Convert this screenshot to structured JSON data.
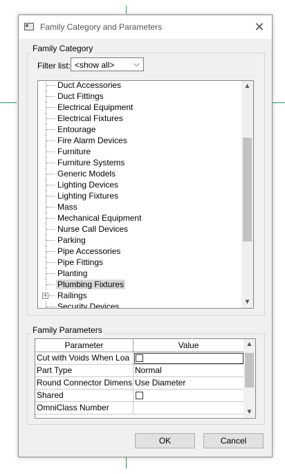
{
  "dialog": {
    "title": "Family Category and Parameters",
    "close_glyph": "✕"
  },
  "family_category": {
    "group_label": "Family Category",
    "filter_label": "Filter list:",
    "filter_value": "<show all>",
    "items": [
      {
        "label": "Duct Accessories"
      },
      {
        "label": "Duct Fittings"
      },
      {
        "label": "Electrical Equipment"
      },
      {
        "label": "Electrical Fixtures"
      },
      {
        "label": "Entourage"
      },
      {
        "label": "Fire Alarm Devices"
      },
      {
        "label": "Furniture"
      },
      {
        "label": "Furniture Systems"
      },
      {
        "label": "Generic Models"
      },
      {
        "label": "Lighting Devices"
      },
      {
        "label": "Lighting Fixtures"
      },
      {
        "label": "Mass"
      },
      {
        "label": "Mechanical Equipment"
      },
      {
        "label": "Nurse Call Devices"
      },
      {
        "label": "Parking"
      },
      {
        "label": "Pipe Accessories"
      },
      {
        "label": "Pipe Fittings"
      },
      {
        "label": "Planting"
      },
      {
        "label": "Plumbing Fixtures",
        "selected": true
      },
      {
        "label": "Railings",
        "expandable": true
      },
      {
        "label": "Security Devices"
      }
    ]
  },
  "family_parameters": {
    "group_label": "Family Parameters",
    "columns": [
      "Parameter",
      "Value"
    ],
    "rows": [
      {
        "parameter": "Cut with Voids When Loa",
        "value": "",
        "checkbox": true,
        "checked": false
      },
      {
        "parameter": "Part Type",
        "value": "Normal"
      },
      {
        "parameter": "Round Connector Dimens",
        "value": "Use Diameter"
      },
      {
        "parameter": "Shared",
        "value": "",
        "checkbox": true,
        "checked": false
      },
      {
        "parameter": "OmniClass Number",
        "value": ""
      }
    ]
  },
  "buttons": {
    "ok": "OK",
    "cancel": "Cancel"
  },
  "colors": {
    "dialog_bg": "#f0f0f0",
    "titlebar_bg": "#ffffff",
    "selection_bg": "#d9d9d9",
    "guide_lines": "#1f9a4a"
  }
}
